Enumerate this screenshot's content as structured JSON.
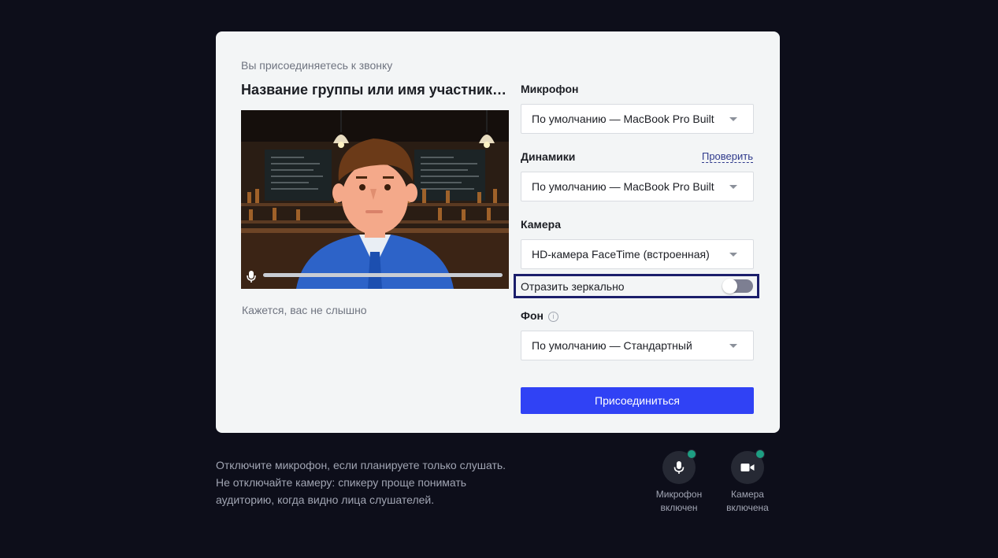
{
  "card": {
    "joining_text": "Вы присоединяетесь к звонку",
    "title": "Название группы или имя участника..."
  },
  "preview": {
    "mic_hint": "Кажется, вас не слышно",
    "level": 0
  },
  "settings": {
    "microphone": {
      "label": "Микрофон",
      "value": "По умолчанию — MacBook Pro Built-in Microphone"
    },
    "speakers": {
      "label": "Динамики",
      "value": "По умолчанию — MacBook Pro Built-in Speakers",
      "check_label": "Проверить"
    },
    "camera": {
      "label": "Камера",
      "value": "HD-камера FaceTime (встроенная)"
    },
    "mirror": {
      "label": "Отразить зеркально",
      "enabled": false
    },
    "background": {
      "label": "Фон",
      "value": "По умолчанию — Стандартный"
    },
    "join_label": "Присоединиться"
  },
  "footer": {
    "note_lines": [
      "Отключите микрофон, если планируете только слушать.",
      "Не отключайте камеру: спикеру проще понимать",
      "аудиторию, когда видно лица слушателей."
    ],
    "mic": {
      "caption_1": "Микрофон",
      "caption_2": "включен",
      "status": "on"
    },
    "camera": {
      "caption_1": "Камера",
      "caption_2": "включена",
      "status": "on"
    }
  },
  "colors": {
    "page_bg": "#0d0e1a",
    "card_bg": "#f3f5f6",
    "accent": "#3042f5",
    "status_on": "#1d9e82",
    "focus_ring": "#1b1e6b"
  }
}
